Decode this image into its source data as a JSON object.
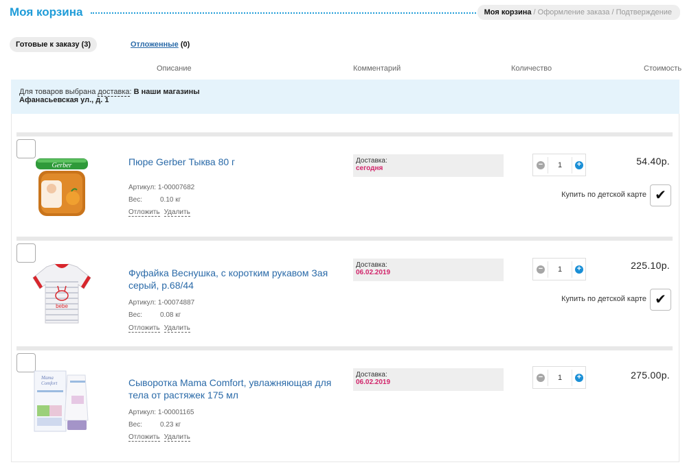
{
  "header": {
    "title": "Моя корзина",
    "breadcrumb": {
      "current": "Моя корзина",
      "sep1": " / ",
      "step2": "Оформление заказа",
      "sep2": " / ",
      "step3": "Подтверждение"
    }
  },
  "tabs": {
    "ready": "Готовые к заказу (3)",
    "deferred_link": "Отложенные",
    "deferred_count": "(0)"
  },
  "columns": {
    "description": "Описание",
    "comment": "Комментарий",
    "quantity": "Количество",
    "cost": "Стоимость"
  },
  "delivery_info": {
    "prefix": "Для товаров выбрана ",
    "link": "доставка",
    "colon": ": ",
    "method": "В наши магазины",
    "address": "Афанасьевская ул., д. 1"
  },
  "labels": {
    "article": "Артикул: ",
    "weight": "Вес:",
    "defer": "Отложить",
    "delete": "Удалить",
    "delivery": "Доставка:",
    "kids_card": "Купить по детской карте",
    "check_glyph": "✔",
    "minus_glyph": "−",
    "plus_glyph": "+"
  },
  "items": [
    {
      "name": "Пюре Gerber Тыква 80 г",
      "article": "1-00007682",
      "weight": "0.10 кг",
      "delivery_when": "сегодня",
      "quantity": "1",
      "price": "54.40р.",
      "image_icon": "baby-food-jar-icon",
      "kids_card_checked": true
    },
    {
      "name": "Фуфайка Веснушка, с коротким рукавом Зая серый, р.68/44",
      "article": "1-00074887",
      "weight": "0.08 кг",
      "delivery_when": "06.02.2019",
      "quantity": "1",
      "price": "225.10р.",
      "image_icon": "baby-tshirt-icon",
      "kids_card_checked": true
    },
    {
      "name": "Сыворотка Mama Comfort, увлажняющая для тела от растяжек 175 мл",
      "article": "1-00001165",
      "weight": "0.23 кг",
      "delivery_when": "06.02.2019",
      "quantity": "1",
      "price": "275.00р.",
      "image_icon": "cream-tube-icon",
      "kids_card_checked": false
    }
  ],
  "colors": {
    "accent": "#1f9cd8",
    "link": "#2a6aa8",
    "delivery_date": "#d1246a",
    "info_bg": "#e5f3fb"
  }
}
